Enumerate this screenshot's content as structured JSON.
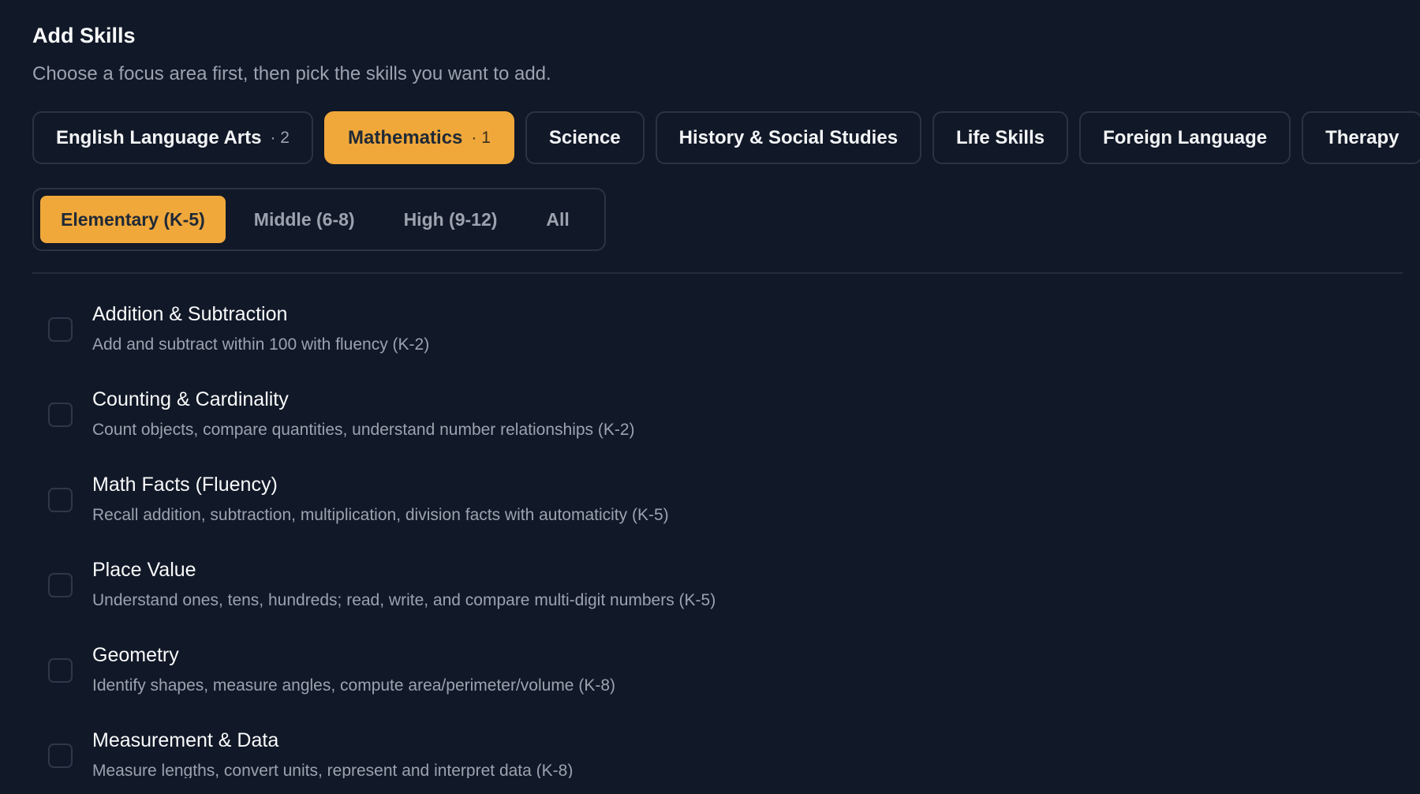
{
  "header": {
    "title": "Add Skills",
    "subtitle": "Choose a focus area first, then pick the skills you want to add."
  },
  "focus_areas": [
    {
      "label": "English Language Arts",
      "count": "· 2"
    },
    {
      "label": "Mathematics",
      "count": "· 1",
      "active": true
    },
    {
      "label": "Science"
    },
    {
      "label": "History & Social Studies"
    },
    {
      "label": "Life Skills"
    },
    {
      "label": "Foreign Language"
    },
    {
      "label": "Therapy"
    }
  ],
  "grade_levels": [
    {
      "label": "Elementary (K-5)",
      "active": true
    },
    {
      "label": "Middle (6-8)"
    },
    {
      "label": "High (9-12)"
    },
    {
      "label": "All"
    }
  ],
  "skills": [
    {
      "name": "Addition & Subtraction",
      "desc": "Add and subtract within 100 with fluency (K-2)",
      "checked": false
    },
    {
      "name": "Counting & Cardinality",
      "desc": "Count objects, compare quantities, understand number relationships (K-2)",
      "checked": false
    },
    {
      "name": "Math Facts (Fluency)",
      "desc": "Recall addition, subtraction, multiplication, division facts with automaticity (K-5)",
      "checked": false
    },
    {
      "name": "Place Value",
      "desc": "Understand ones, tens, hundreds; read, write, and compare multi-digit numbers (K-5)",
      "checked": false
    },
    {
      "name": "Geometry",
      "desc": "Identify shapes, measure angles, compute area/perimeter/volume (K-8)",
      "checked": false
    },
    {
      "name": "Measurement & Data",
      "desc": "Measure lengths, convert units, represent and interpret data (K-8)",
      "checked": false
    }
  ],
  "colors": {
    "background": "#111827",
    "accent": "#f0a83a",
    "border": "#2b3442",
    "muted_text": "#9ca3af"
  }
}
